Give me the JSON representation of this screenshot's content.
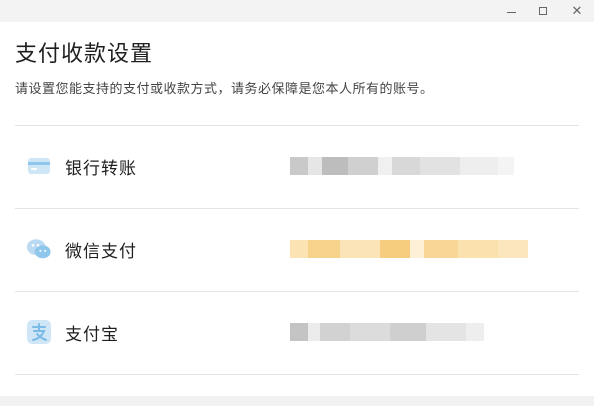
{
  "window": {
    "minimize_glyph": "",
    "maximize_glyph": "",
    "close_glyph": "✕"
  },
  "header": {
    "title": "支付收款设置",
    "subtitle": "请设置您能支持的支付或收款方式，请务必保障是您本人所有的账号。"
  },
  "methods": [
    {
      "label": "银行转账",
      "icon": "bank-card-icon",
      "icon_color": "#8fc7ec",
      "account_masked": true,
      "mask_color": "#bdbdbd"
    },
    {
      "label": "微信支付",
      "icon": "wechat-icon",
      "icon_color": "#7cbbe6",
      "account_masked": true,
      "mask_color": "#f6cf7a"
    },
    {
      "label": "支付宝",
      "icon": "alipay-icon",
      "icon_color": "#8fc7ec",
      "account_masked": true,
      "mask_color": "#c4c4c4"
    }
  ]
}
